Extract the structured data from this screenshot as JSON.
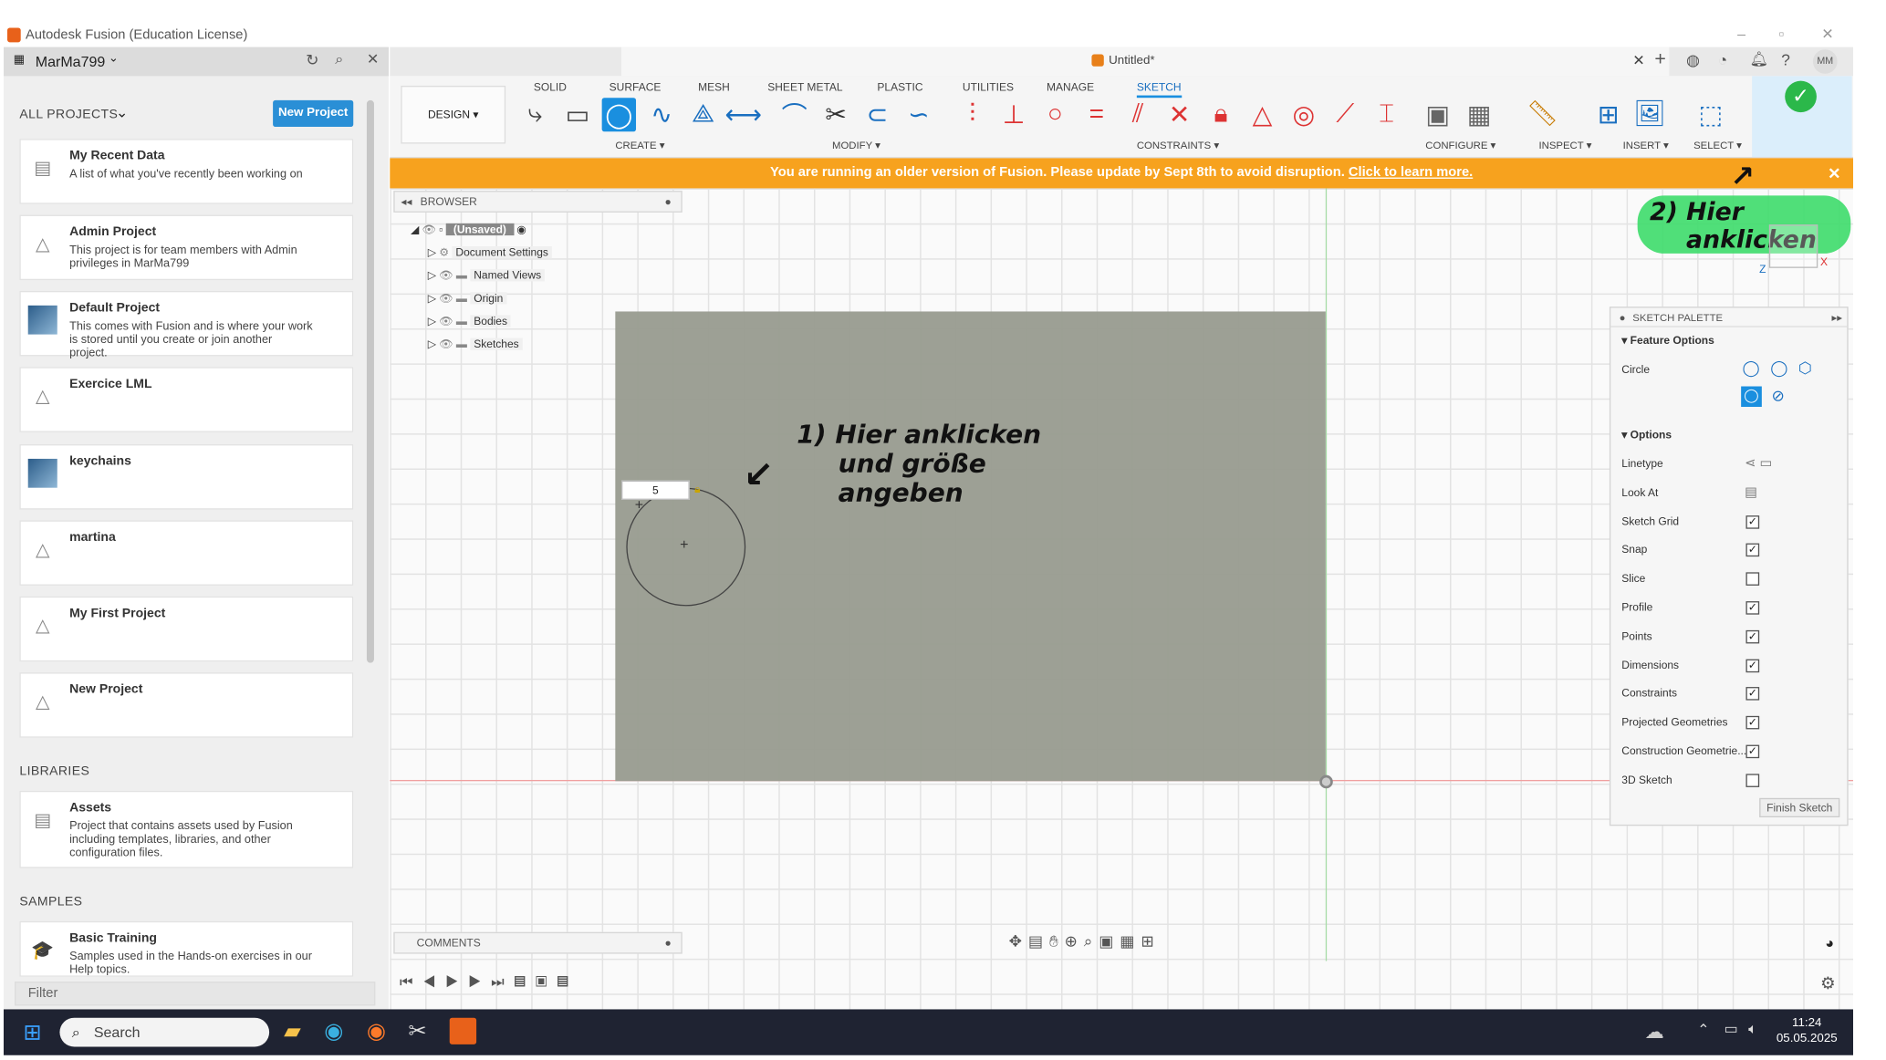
{
  "window": {
    "title": "Autodesk Fusion (Education License)",
    "doc_title": "Untitled*",
    "avatar": "MM"
  },
  "user": {
    "name": "MarMa799"
  },
  "projects": {
    "header": "ALL PROJECTS",
    "new_button": "New Project",
    "items": [
      {
        "title": "My Recent Data",
        "desc": "A list of what you've recently been working on",
        "icon": "recent-data-icon"
      },
      {
        "title": "Admin Project",
        "desc": "This project is for team members with Admin privileges in MarMa799",
        "icon": "project-icon"
      },
      {
        "title": "Default Project",
        "desc": "This comes with Fusion and is where your work is stored until you create or join another project.",
        "icon": "project-thumbnail"
      },
      {
        "title": "Exercice LML",
        "desc": "",
        "icon": "project-icon"
      },
      {
        "title": "keychains",
        "desc": "",
        "icon": "project-thumbnail"
      },
      {
        "title": "martina",
        "desc": "",
        "icon": "project-icon"
      },
      {
        "title": "My First Project",
        "desc": "",
        "icon": "project-icon"
      },
      {
        "title": "New Project",
        "desc": "",
        "icon": "project-icon"
      }
    ]
  },
  "libraries": {
    "header": "LIBRARIES",
    "items": [
      {
        "title": "Assets",
        "desc": "Project that contains assets used by Fusion including templates, libraries, and other configuration files."
      }
    ]
  },
  "samples": {
    "header": "SAMPLES",
    "items": [
      {
        "title": "Basic Training",
        "desc": "Samples used in the Hands-on exercises in our Help topics."
      }
    ]
  },
  "filter": {
    "placeholder": "Filter"
  },
  "ribbon": {
    "workspace": "DESIGN",
    "tabs": [
      "SOLID",
      "SURFACE",
      "MESH",
      "SHEET METAL",
      "PLASTIC",
      "UTILITIES",
      "MANAGE",
      "SKETCH"
    ],
    "active_tab": "SKETCH",
    "groups": [
      "CREATE",
      "MODIFY",
      "CONSTRAINTS",
      "CONFIGURE",
      "INSPECT",
      "INSERT",
      "SELECT",
      "FINISH SKETCH"
    ]
  },
  "banner": {
    "text": "You are running an older version of Fusion. Please update by Sept 8th to avoid disruption.",
    "link": "Click to learn more."
  },
  "browser": {
    "title": "BROWSER",
    "root": "(Unsaved)",
    "items": [
      "Document Settings",
      "Named Views",
      "Origin",
      "Bodies",
      "Sketches"
    ]
  },
  "sketch": {
    "dimension_value": "5"
  },
  "annotations": {
    "note1_lines": [
      "1) Hier anklicken",
      "und größe",
      "angeben"
    ],
    "note2_lines": [
      "2) Hier",
      "anklicken"
    ]
  },
  "palette": {
    "title": "SKETCH PALETTE",
    "feature_options": "Feature Options",
    "circle_label": "Circle",
    "options_header": "Options",
    "options": [
      {
        "label": "Linetype",
        "control": "icon"
      },
      {
        "label": "Look At",
        "control": "icon"
      },
      {
        "label": "Sketch Grid",
        "checked": true
      },
      {
        "label": "Snap",
        "checked": true
      },
      {
        "label": "Slice",
        "checked": false
      },
      {
        "label": "Profile",
        "checked": true
      },
      {
        "label": "Points",
        "checked": true
      },
      {
        "label": "Dimensions",
        "checked": true
      },
      {
        "label": "Constraints",
        "checked": true
      },
      {
        "label": "Projected Geometries",
        "checked": true
      },
      {
        "label": "Construction Geometrie...",
        "checked": true
      },
      {
        "label": "3D Sketch",
        "checked": false
      }
    ],
    "finish_button": "Finish Sketch"
  },
  "comments": {
    "label": "COMMENTS"
  },
  "viewcube": {
    "z": "Z",
    "x": "X"
  },
  "taskbar": {
    "search": "Search",
    "time": "11:24",
    "date": "05.05.2025"
  },
  "colors": {
    "banner": "#f7a21e",
    "accent": "#1a8fdf",
    "finish_green": "#2bb84a",
    "highlighter": "#3ddc6a"
  }
}
